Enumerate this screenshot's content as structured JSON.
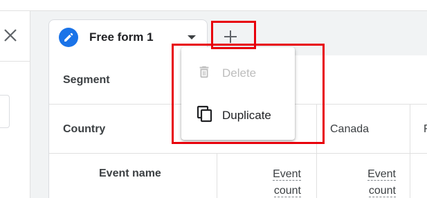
{
  "tab": {
    "label": "Free form 1"
  },
  "menu": {
    "items": [
      {
        "label": "Delete",
        "icon": "delete-icon",
        "disabled": true
      },
      {
        "label": "Duplicate",
        "icon": "duplicate-icon",
        "disabled": false
      }
    ]
  },
  "table": {
    "segment_label": "Segment",
    "country_label": "Country",
    "country_values": [
      "Canada",
      "F"
    ],
    "row_dimension": "Event name",
    "metric_label": "Event count",
    "metric_line1": "Event",
    "metric_line2": "count"
  },
  "colors": {
    "accent": "#1a73e8",
    "highlight": "#e8000b"
  }
}
